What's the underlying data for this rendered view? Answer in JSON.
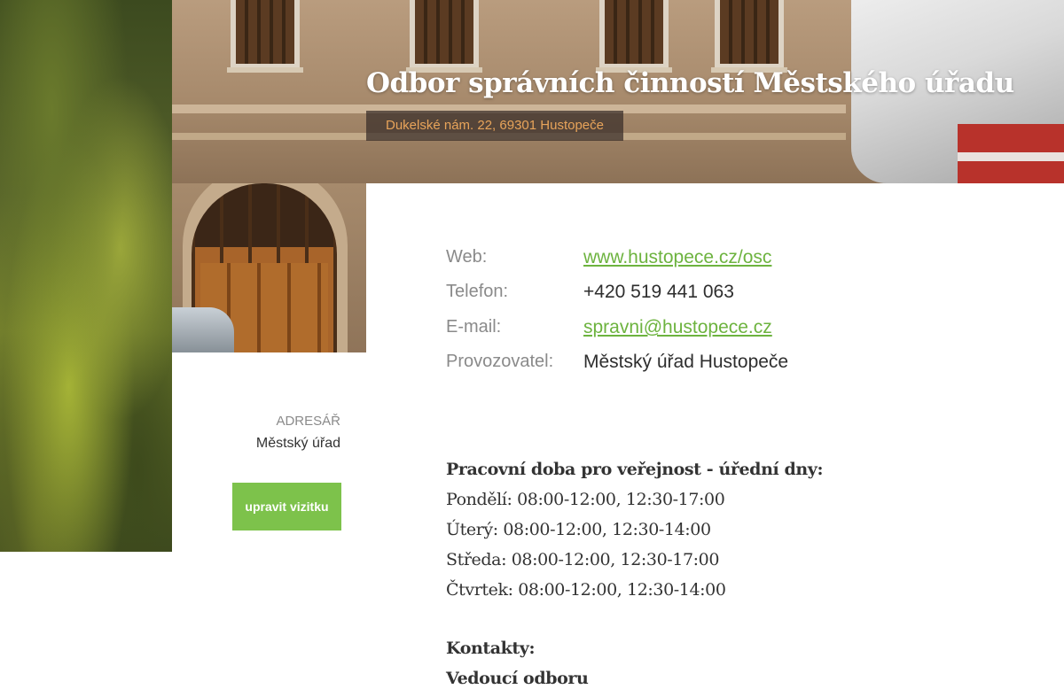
{
  "hero": {
    "title": "Odbor správních činností Městského úřadu",
    "address": "Dukelské nám. 22, 69301 Hustopeče"
  },
  "sidebar": {
    "category_label": "ADRESÁŘ",
    "category_value": "Městský úřad",
    "edit_button_label": "upravit vizitku"
  },
  "info": {
    "web_label": "Web:",
    "web_value": "www.hustopece.cz/osc",
    "phone_label": "Telefon:",
    "phone_value": "+420 519 441 063",
    "email_label": "E-mail:",
    "email_value": "spravni@hustopece.cz",
    "operator_label": "Provozovatel:",
    "operator_value": "Městský úřad Hustopeče"
  },
  "hours": {
    "heading": "Pracovní doba pro veřejnost - úřední dny:",
    "lines": [
      "Pondělí: 08:00-12:00, 12:30-17:00",
      "Úterý: 08:00-12:00, 12:30-14:00",
      "Středa: 08:00-12:00, 12:30-17:00",
      "Čtvrtek: 08:00-12:00, 12:30-14:00"
    ]
  },
  "contacts": {
    "heading": "Kontakty:",
    "subheading": "Vedoucí odboru"
  },
  "colors": {
    "accent_green": "#7dc24b",
    "link_green": "#6db33f",
    "address_orange": "#e8a45a"
  }
}
